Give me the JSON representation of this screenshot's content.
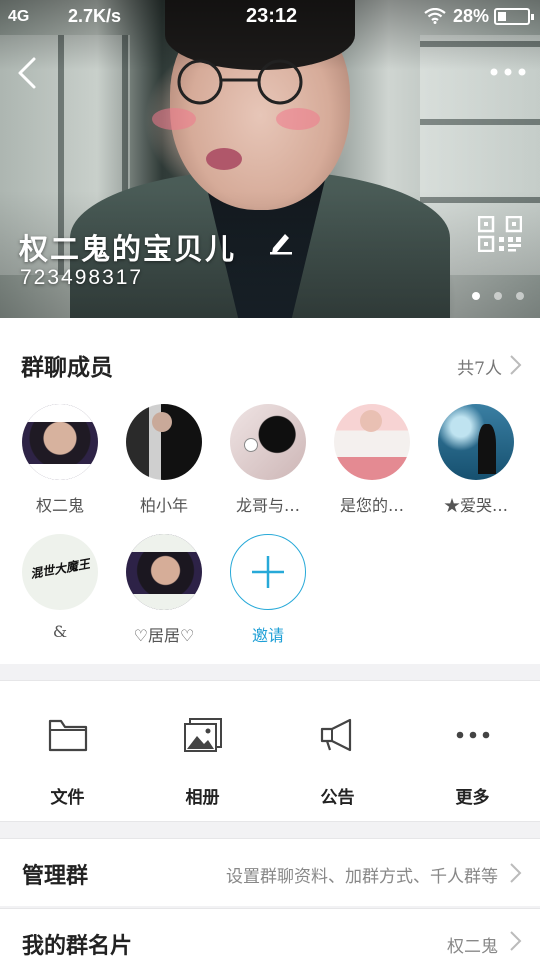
{
  "status_bar": {
    "network": "4G",
    "speed": "2.7K/s",
    "time": "23:12",
    "battery_percent": "28%",
    "battery_level": 0.28
  },
  "header": {
    "group_name": "权二鬼的宝贝儿",
    "group_id": "723498317",
    "icons": [
      "back-arrow-icon",
      "more-dots-icon",
      "edit-pencil-icon",
      "qr-code-icon"
    ],
    "page_count": 3,
    "active_page": 0
  },
  "members_section": {
    "title": "群聊成员",
    "count_label": "共7人",
    "members": [
      {
        "name": "权二鬼"
      },
      {
        "name": "柏小年"
      },
      {
        "name": "龙哥与…"
      },
      {
        "name": "是您的…"
      },
      {
        "name": "★爱哭…"
      },
      {
        "name": "&",
        "avatar_text": "混世大魔王"
      },
      {
        "name": "♡居居♡"
      }
    ],
    "invite_label": "邀请"
  },
  "actions": [
    {
      "label": "文件",
      "icon": "folder-icon"
    },
    {
      "label": "相册",
      "icon": "album-icon"
    },
    {
      "label": "公告",
      "icon": "megaphone-icon"
    },
    {
      "label": "更多",
      "icon": "more-horizontal-icon"
    }
  ],
  "rows": {
    "manage": {
      "label": "管理群",
      "value": "设置群聊资料、加群方式、千人群等"
    },
    "card": {
      "label": "我的群名片",
      "value": "权二鬼"
    }
  },
  "colors": {
    "accent": "#1e9fd6",
    "background": "#f2f2f4",
    "card": "#ffffff"
  }
}
